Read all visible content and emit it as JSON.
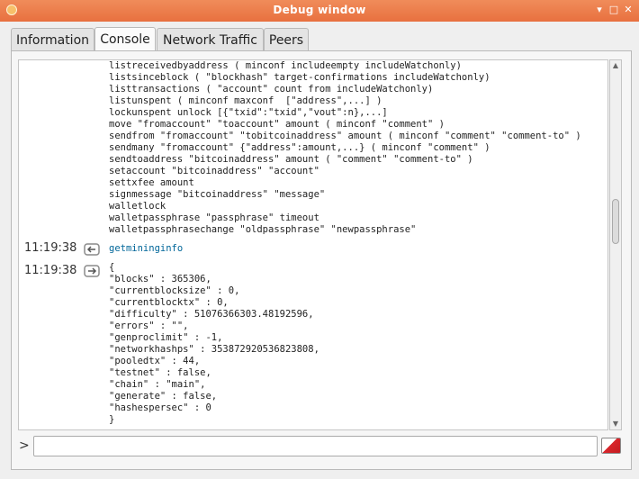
{
  "window": {
    "title": "Debug window",
    "minimize": "▾",
    "maximize": "□",
    "close": "✕"
  },
  "tabs": [
    {
      "label": "Information",
      "active": false
    },
    {
      "label": "Console",
      "active": true
    },
    {
      "label": "Network Traffic",
      "active": false
    },
    {
      "label": "Peers",
      "active": false
    }
  ],
  "help_lines": [
    "listreceivedbyaddress ( minconf includeempty includeWatchonly)",
    "listsinceblock ( \"blockhash\" target-confirmations includeWatchonly)",
    "listtransactions ( \"account\" count from includeWatchonly)",
    "listunspent ( minconf maxconf  [\"address\",...] )",
    "lockunspent unlock [{\"txid\":\"txid\",\"vout\":n},...]",
    "move \"fromaccount\" \"toaccount\" amount ( minconf \"comment\" )",
    "sendfrom \"fromaccount\" \"tobitcoinaddress\" amount ( minconf \"comment\" \"comment-to\" )",
    "sendmany \"fromaccount\" {\"address\":amount,...} ( minconf \"comment\" )",
    "sendtoaddress \"bitcoinaddress\" amount ( \"comment\" \"comment-to\" )",
    "setaccount \"bitcoinaddress\" \"account\"",
    "settxfee amount",
    "signmessage \"bitcoinaddress\" \"message\"",
    "walletlock",
    "walletpassphrase \"passphrase\" timeout",
    "walletpassphrasechange \"oldpassphrase\" \"newpassphrase\""
  ],
  "request": {
    "timestamp": "11:19:38",
    "command": "getmininginfo"
  },
  "reply": {
    "timestamp": "11:19:38",
    "lines": [
      "{",
      "\"blocks\" : 365306,",
      "\"currentblocksize\" : 0,",
      "\"currentblocktx\" : 0,",
      "\"difficulty\" : 51076366303.48192596,",
      "\"errors\" : \"\",",
      "\"genproclimit\" : -1,",
      "\"networkhashps\" : 353872920536823808,",
      "\"pooledtx\" : 44,",
      "\"testnet\" : false,",
      "\"chain\" : \"main\",",
      "\"generate\" : false,",
      "\"hashespersec\" : 0",
      "}"
    ]
  },
  "input": {
    "prompt": ">",
    "value": ""
  },
  "colors": {
    "titlebar": "#e8703f",
    "command": "#006699",
    "clear": "#d8262b"
  }
}
